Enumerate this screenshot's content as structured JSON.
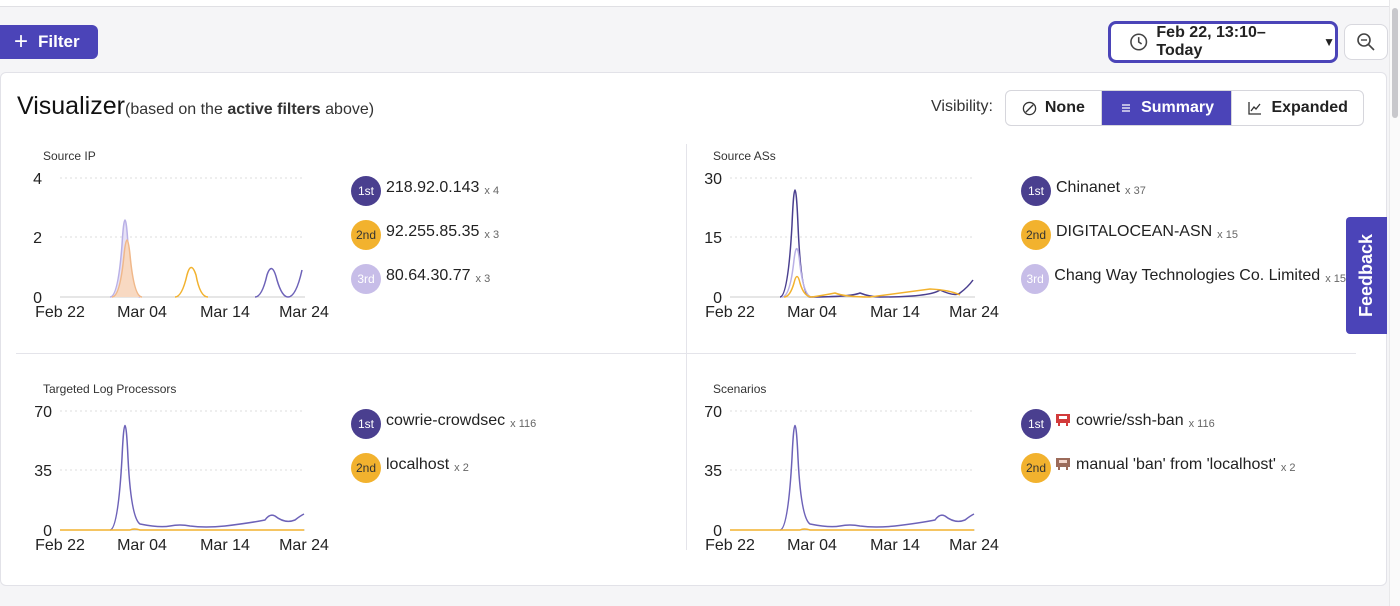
{
  "toolbar": {
    "filter_label": "Filter",
    "date_range": "Feb 22, 13:10–Today"
  },
  "visualizer": {
    "title": "Visualizer",
    "subtitle_pre": "(based on the",
    "subtitle_bold": "active filters",
    "subtitle_post": "above)",
    "visibility_label": "Visibility:",
    "options": [
      "None",
      "Summary",
      "Expanded"
    ],
    "selected": "Summary"
  },
  "feedback_label": "Feedback",
  "colors": {
    "accent": "#4b44b8",
    "first": "#4a3f8f",
    "second": "#f2b22e",
    "third": "#c7bde8"
  },
  "cards": [
    {
      "title": "Source IP",
      "y_ticks": [
        "4",
        "2",
        "0"
      ],
      "x_ticks": [
        "Feb 22",
        "Mar 04",
        "Mar 14",
        "Mar 24"
      ],
      "top": [
        {
          "rank": "1st",
          "value": "218.92.0.143",
          "count": "x 4"
        },
        {
          "rank": "2nd",
          "value": "92.255.85.35",
          "count": "x 3"
        },
        {
          "rank": "3rd",
          "value": "80.64.30.77",
          "count": "x 3"
        }
      ]
    },
    {
      "title": "Source ASs",
      "y_ticks": [
        "30",
        "15",
        "0"
      ],
      "x_ticks": [
        "Feb 22",
        "Mar 04",
        "Mar 14",
        "Mar 24"
      ],
      "top": [
        {
          "rank": "1st",
          "value": "Chinanet",
          "count": "x 37"
        },
        {
          "rank": "2nd",
          "value": "DIGITALOCEAN-ASN",
          "count": "x 15"
        },
        {
          "rank": "3rd",
          "value": "Chang Way Technologies Co. Limited",
          "count": "x 15"
        }
      ]
    },
    {
      "title": "Targeted Log Processors",
      "y_ticks": [
        "70",
        "35",
        "0"
      ],
      "x_ticks": [
        "Feb 22",
        "Mar 04",
        "Mar 14",
        "Mar 24"
      ],
      "top": [
        {
          "rank": "1st",
          "value": "cowrie-crowdsec",
          "count": "x 116"
        },
        {
          "rank": "2nd",
          "value": "localhost",
          "count": "x 2"
        }
      ]
    },
    {
      "title": "Scenarios",
      "y_ticks": [
        "70",
        "35",
        "0"
      ],
      "x_ticks": [
        "Feb 22",
        "Mar 04",
        "Mar 14",
        "Mar 24"
      ],
      "top": [
        {
          "rank": "1st",
          "value": "cowrie/ssh-ban",
          "count": "x 116"
        },
        {
          "rank": "2nd",
          "value": "manual 'ban' from 'localhost'",
          "count": "x 2"
        }
      ]
    }
  ]
}
